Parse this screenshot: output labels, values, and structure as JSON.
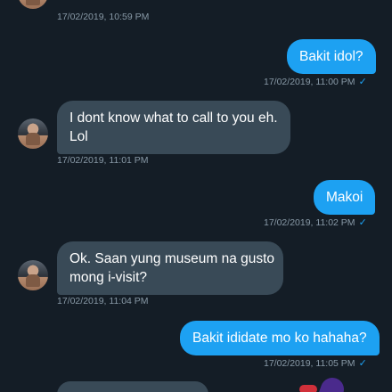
{
  "messages": [
    {
      "dir": "in",
      "text": "",
      "time": "17/02/2019, 10:59 PM"
    },
    {
      "dir": "out",
      "text": "Bakit idol?",
      "time": "17/02/2019, 11:00 PM",
      "read": "✓"
    },
    {
      "dir": "in",
      "line1": "I dont know what to call to you eh.",
      "line2": "Lol",
      "time": "17/02/2019, 11:01 PM"
    },
    {
      "dir": "out",
      "text": "Makoi",
      "time": "17/02/2019, 11:02 PM",
      "read": "✓"
    },
    {
      "dir": "in",
      "line1": "Ok. Saan yung museum na gusto",
      "line2": "mong i-visit?",
      "time": "17/02/2019, 11:04 PM"
    },
    {
      "dir": "out",
      "text": "Bakit ididate mo ko hahaha?",
      "time": "17/02/2019, 11:05 PM",
      "read": "✓"
    }
  ],
  "icons": {
    "avatar": "profile-photo",
    "read_receipt": "checkmark-icon"
  },
  "colors": {
    "background": "#141d26",
    "incoming_bubble": "#394a57",
    "outgoing_bubble": "#1da1f2",
    "timestamp": "#8899a6",
    "read_check": "#1da1f2"
  }
}
